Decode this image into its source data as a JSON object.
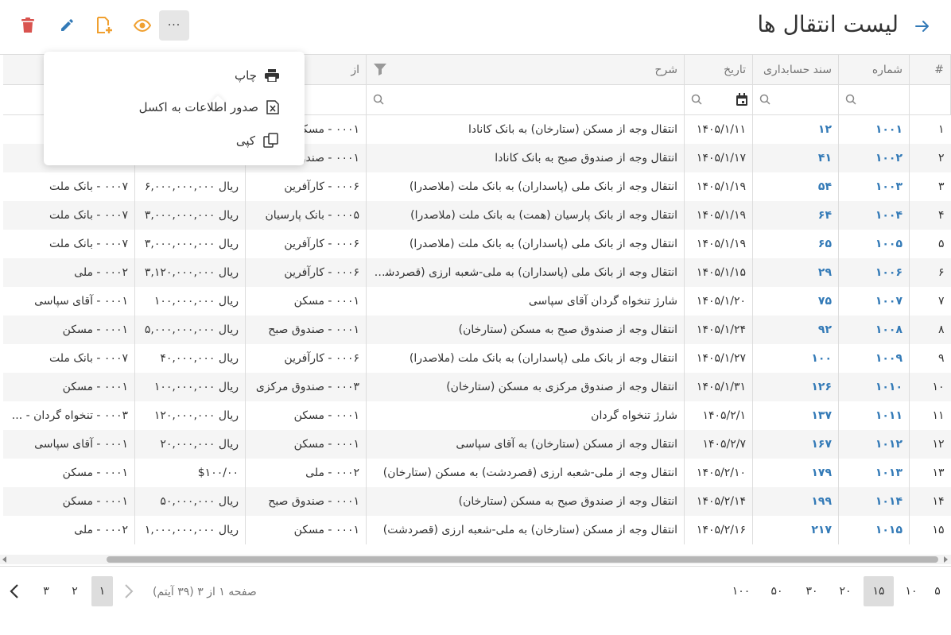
{
  "header": {
    "title": "لیست انتقال ها",
    "more_label": "···"
  },
  "toolbar": {
    "icons": [
      "back-arrow-icon",
      "more-icon",
      "view-icon",
      "add-doc-icon",
      "edit-icon",
      "delete-icon"
    ],
    "colors": {
      "view": "#f0a030",
      "add": "#f0a030",
      "edit": "#337ab7",
      "delete": "#d9534f"
    }
  },
  "menu": {
    "items": [
      {
        "label": "چاپ",
        "icon": "print-icon"
      },
      {
        "label": "صدور اطلاعات به اکسل",
        "icon": "excel-icon"
      },
      {
        "label": "کپی",
        "icon": "copy-icon"
      }
    ]
  },
  "table": {
    "columns": [
      "#",
      "شماره",
      "سند حسابداری",
      "تاریخ",
      "شرح",
      "از",
      "",
      ""
    ],
    "rows": [
      [
        "۱",
        "۱۰۰۱",
        "۱۲",
        "۱۴۰۵/۱/۱۱",
        "انتقال وجه از مسکن (ستارخان) به بانک کانادا",
        "۰۰۰۱ - مسکن",
        "",
        ""
      ],
      [
        "۲",
        "۱۰۰۲",
        "۴۱",
        "۱۴۰۵/۱/۱۷",
        "انتقال وجه از صندوق صبح به بانک کانادا",
        "۰۰۰۱ - صندوق صبح",
        "",
        ""
      ],
      [
        "۳",
        "۱۰۰۳",
        "۵۴",
        "۱۴۰۵/۱/۱۹",
        "انتقال وجه از بانک ملی (پاسداران) به بانک ملت (ملاصدرا)",
        "۰۰۰۶ - کارآفرین",
        "ریال ۶,۰۰۰,۰۰۰,۰۰۰",
        "۰۰۰۷ - بانک ملت"
      ],
      [
        "۴",
        "۱۰۰۴",
        "۶۴",
        "۱۴۰۵/۱/۱۹",
        "انتقال وجه از بانک پارسیان (همت) به بانک ملت (ملاصدرا)",
        "۰۰۰۵ - بانک پارسیان",
        "ریال ۳,۰۰۰,۰۰۰,۰۰۰",
        "۰۰۰۷ - بانک ملت"
      ],
      [
        "۵",
        "۱۰۰۵",
        "۶۵",
        "۱۴۰۵/۱/۱۹",
        "انتقال وجه از بانک ملی (پاسداران) به بانک ملت (ملاصدرا)",
        "۰۰۰۶ - کارآفرین",
        "ریال ۳,۰۰۰,۰۰۰,۰۰۰",
        "۰۰۰۷ - بانک ملت"
      ],
      [
        "۶",
        "۱۰۰۶",
        "۲۹",
        "۱۴۰۵/۱/۱۵",
        "انتقال وجه از بانک ملی (پاسداران) به ملی-شعبه ارزی (قصردشت)",
        "۰۰۰۶ - کارآفرین",
        "ریال ۳,۱۲۰,۰۰۰,۰۰۰",
        "۰۰۰۲ - ملی"
      ],
      [
        "۷",
        "۱۰۰۷",
        "۷۵",
        "۱۴۰۵/۱/۲۰",
        "شارژ تنخواه گردان آقای سپاسی",
        "۰۰۰۱ - مسکن",
        "ریال ۱۰۰,۰۰۰,۰۰۰",
        "۰۰۰۱ - آقای سپاسی"
      ],
      [
        "۸",
        "۱۰۰۸",
        "۹۲",
        "۱۴۰۵/۱/۲۴",
        "انتقال وجه از صندوق صبح به مسکن (ستارخان)",
        "۰۰۰۱ - صندوق صبح",
        "ریال ۵,۰۰۰,۰۰۰,۰۰۰",
        "۰۰۰۱ - مسکن"
      ],
      [
        "۹",
        "۱۰۰۹",
        "۱۰۰",
        "۱۴۰۵/۱/۲۷",
        "انتقال وجه از بانک ملی (پاسداران) به بانک ملت (ملاصدرا)",
        "۰۰۰۶ - کارآفرین",
        "ریال ۴۰,۰۰۰,۰۰۰",
        "۰۰۰۷ - بانک ملت"
      ],
      [
        "۱۰",
        "۱۰۱۰",
        "۱۲۶",
        "۱۴۰۵/۱/۳۱",
        "انتقال وجه از صندوق مرکزی به مسکن (ستارخان)",
        "۰۰۰۳ - صندوق مرکزی",
        "ریال ۱۰۰,۰۰۰,۰۰۰",
        "۰۰۰۱ - مسکن"
      ],
      [
        "۱۱",
        "۱۰۱۱",
        "۱۳۷",
        "۱۴۰۵/۲/۱",
        "شارژ تنخواه گردان",
        "۰۰۰۱ - مسکن",
        "ریال ۱۲۰,۰۰۰,۰۰۰",
        "۰۰۰۳ - تنخواه گردان - ..."
      ],
      [
        "۱۲",
        "۱۰۱۲",
        "۱۶۷",
        "۱۴۰۵/۲/۷",
        "انتقال وجه از مسکن (ستارخان) به آقای سپاسی",
        "۰۰۰۱ - مسکن",
        "ریال ۲۰,۰۰۰,۰۰۰",
        "۰۰۰۱ - آقای سپاسی"
      ],
      [
        "۱۳",
        "۱۰۱۳",
        "۱۷۹",
        "۱۴۰۵/۲/۱۰",
        "انتقال وجه از ملی-شعبه ارزی (قصردشت) به مسکن (ستارخان)",
        "۰۰۰۲ - ملی",
        "$۱۰۰/۰۰",
        "۰۰۰۱ - مسکن"
      ],
      [
        "۱۴",
        "۱۰۱۴",
        "۱۹۹",
        "۱۴۰۵/۲/۱۴",
        "انتقال وجه از صندوق صبح به مسکن (ستارخان)",
        "۰۰۰۱ - صندوق صبح",
        "ریال ۵۰,۰۰۰,۰۰۰",
        "۰۰۰۱ - مسکن"
      ],
      [
        "۱۵",
        "۱۰۱۵",
        "۲۱۷",
        "۱۴۰۵/۲/۱۶",
        "انتقال وجه از مسکن (ستارخان) به ملی-شعبه ارزی (قصردشت)",
        "۰۰۰۱ - مسکن",
        "ریال ۱,۰۰۰,۰۰۰,۰۰۰",
        "۰۰۰۲ - ملی"
      ]
    ]
  },
  "pager": {
    "sizes": [
      "۵",
      "۱۰",
      "۱۵",
      "۲۰",
      "۳۰",
      "۵۰",
      "۱۰۰"
    ],
    "selected_size": "۱۵",
    "info": "صفحه ۱ از ۳ (۳۹ آیتم)",
    "pages": [
      "۱",
      "۲",
      "۳"
    ],
    "current_page": "۱"
  }
}
